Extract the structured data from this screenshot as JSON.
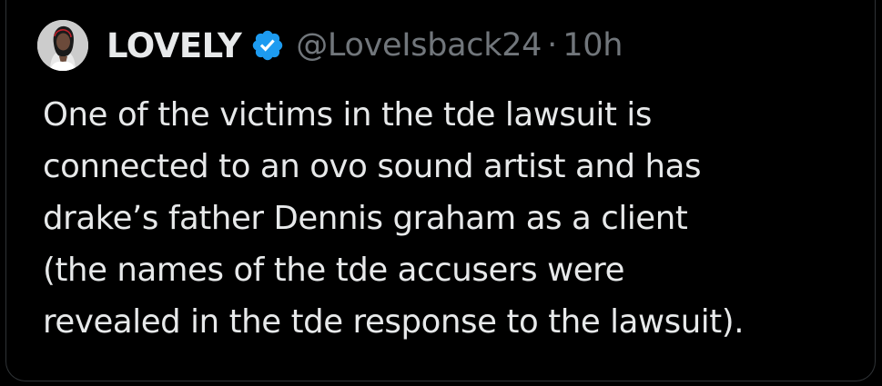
{
  "author": {
    "display_name": "LOVELY",
    "handle": "@LoveIsback24",
    "separator": "·",
    "time": "10h",
    "avatar_icon": "profile-photo",
    "verified_icon": "verified-badge-icon",
    "verified_color": "#1d9bf0"
  },
  "tweet": {
    "lines": [
      "One of the victims in the tde lawsuit is",
      "connected to an ovo sound artist and has",
      "drake’s father Dennis graham as a client",
      "(the names of the tde accusers were",
      "revealed in the tde response to the lawsuit)."
    ]
  },
  "colors": {
    "background": "#000000",
    "text_primary": "#e7e9ea",
    "text_secondary": "#71767b",
    "border": "#2f3336",
    "accent": "#1d9bf0"
  }
}
